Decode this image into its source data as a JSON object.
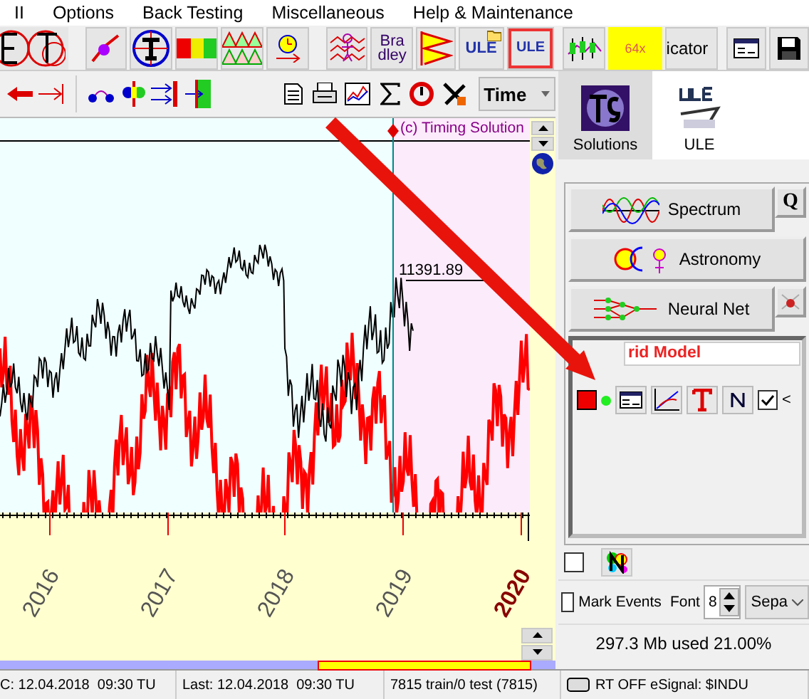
{
  "menu": [
    "II",
    "Options",
    "Back Testing",
    "Miscellaneous",
    "Help & Maintenance"
  ],
  "toolbar": {
    "bradley": "Bra dley",
    "ule_folder": "ULE",
    "ule_boxed": "ULE",
    "badge": "64x",
    "indicator": "icator",
    "time_select": "Time"
  },
  "chart": {
    "copyright": "(c) Timing Solution",
    "price_label": "11391.89",
    "years": [
      {
        "label": "2016",
        "emphasized": false
      },
      {
        "label": "2017",
        "emphasized": false
      },
      {
        "label": "2018",
        "emphasized": false
      },
      {
        "label": "2019",
        "emphasized": false
      },
      {
        "label": "2020",
        "emphasized": true
      }
    ]
  },
  "side_tabs": [
    {
      "label": "Solutions",
      "selected": true
    },
    {
      "label": "ULE",
      "selected": false
    }
  ],
  "modules": [
    {
      "label": "Spectrum",
      "side": "Q"
    },
    {
      "label": "Astronomy"
    },
    {
      "label": "Neural Net"
    }
  ],
  "model": {
    "title": "rid Model",
    "show": true,
    "more": "<"
  },
  "extra_check": false,
  "mark_events": {
    "label": "Mark Events",
    "checked": false
  },
  "font": {
    "label": "Font",
    "value": "8"
  },
  "separator_select": "Sepa",
  "memory": "297.3 Mb used 21.00%",
  "status": [
    "C: 12.04.2018  09:30 TU",
    "Last: 12.04.2018  09:30 TU",
    "7815 train/0 test (7815)",
    "RT OFF eSignal: $INDU"
  ]
}
